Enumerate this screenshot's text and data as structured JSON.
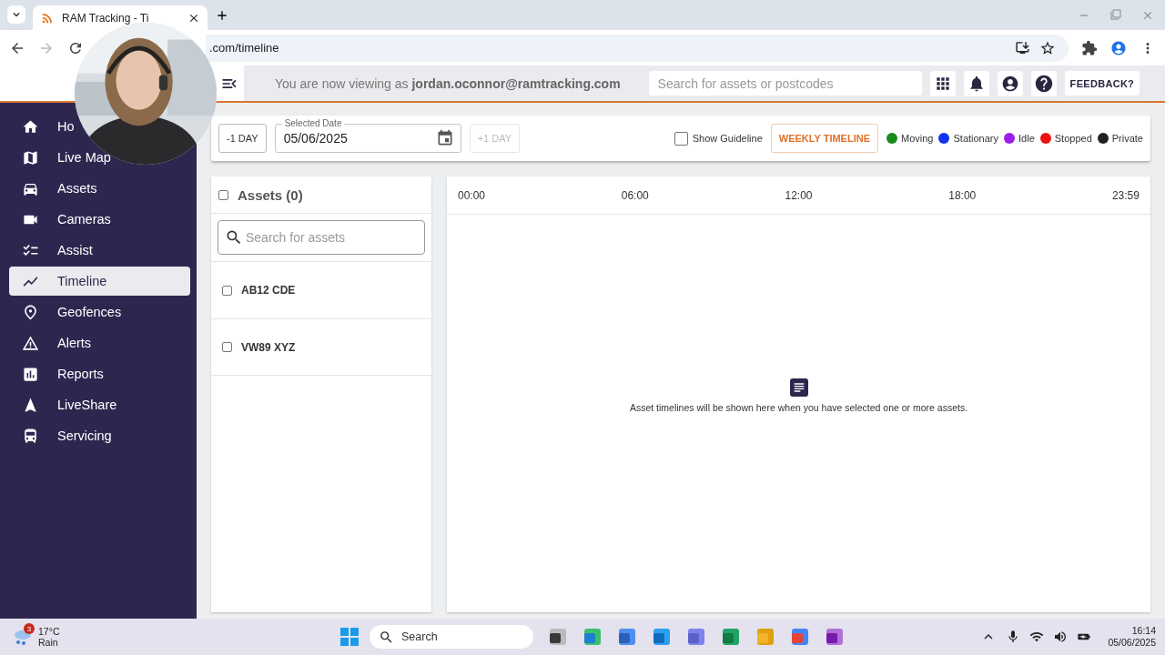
{
  "browser": {
    "tab_title": "RAM Tracking - Ti",
    "url": ".com/timeline"
  },
  "header": {
    "viewing": "You are now viewing as **jordan.oconnor@ramtracking.com**",
    "search_placeholder": "Search for assets or postcodes",
    "feedback": "FEEDBACK?"
  },
  "sidebar": {
    "items": [
      {
        "label": "Ho",
        "selected": false
      },
      {
        "label": "Live Map",
        "selected": false
      },
      {
        "label": "Assets",
        "selected": false
      },
      {
        "label": "Cameras",
        "selected": false
      },
      {
        "label": "Assist",
        "selected": false
      },
      {
        "label": "Timeline",
        "selected": true
      },
      {
        "label": "Geofences",
        "selected": false
      },
      {
        "label": "Alerts",
        "selected": false
      },
      {
        "label": "Reports",
        "selected": false
      },
      {
        "label": "LiveShare",
        "selected": false
      },
      {
        "label": "Servicing",
        "selected": false
      }
    ]
  },
  "toolbar": {
    "prev_day": "-1 DAY",
    "date_label": "Selected Date",
    "date_value": "05/06/2025",
    "next_day": {
      "label": "+1 DAY",
      "disabled": true
    },
    "guideline": {
      "label": "Show Guideline",
      "checked": false
    },
    "weekly": "WEEKLY TIMELINE",
    "legend": [
      {
        "label": "Moving",
        "color": "#1a8a1a"
      },
      {
        "label": "Stationary",
        "color": "#1133ee"
      },
      {
        "label": "Idle",
        "color": "#9b1fe8"
      },
      {
        "label": "Stopped",
        "color": "#ee1111"
      },
      {
        "label": "Private",
        "color": "#222222"
      }
    ]
  },
  "assets": {
    "title": "Assets (0)",
    "checked": false,
    "search_placeholder": "Search for assets",
    "rows": [
      {
        "plate": "AB12 CDE",
        "checked": false
      },
      {
        "plate": "VW89 XYZ",
        "checked": false
      }
    ]
  },
  "timeline": {
    "ticks": [
      "00:00",
      "06:00",
      "12:00",
      "18:00",
      "23:59"
    ],
    "empty_message": "Asset timelines will be shown here when you have selected one or more assets."
  },
  "taskbar": {
    "weather_badge": "3",
    "temperature": "17°C",
    "condition": "Rain",
    "search": "Search",
    "time": "16:14",
    "date": "05/06/2025"
  }
}
